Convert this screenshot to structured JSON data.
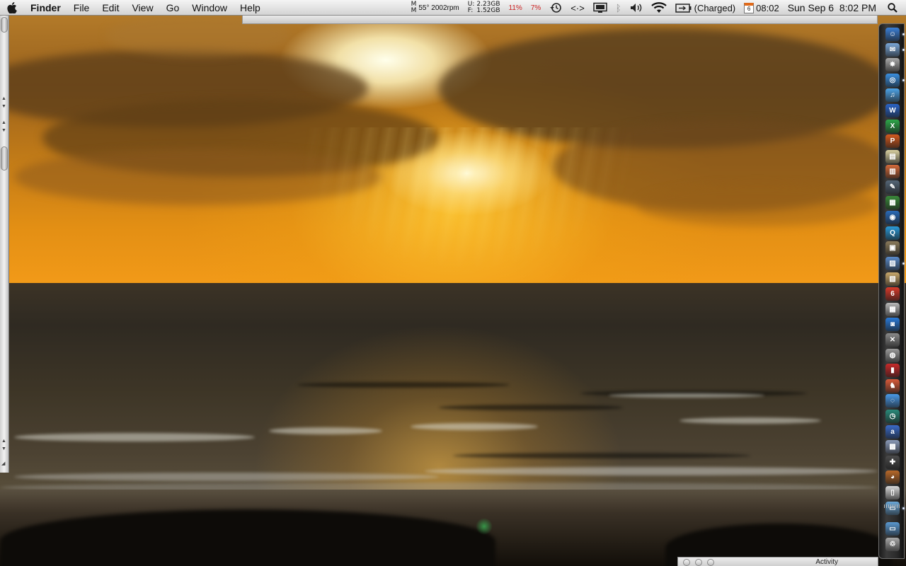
{
  "menubar": {
    "app_name": "Finder",
    "menus": [
      "File",
      "Edit",
      "View",
      "Go",
      "Window",
      "Help"
    ],
    "extras": {
      "temp_top": "M",
      "temp_bottom": "M",
      "temp_fan": "55° 2002rpm",
      "mem_u_label": "U:",
      "mem_f_label": "F:",
      "mem_used": "2.23GB",
      "mem_free": "1.52GB",
      "cpu1": "11%",
      "cpu2": "7%",
      "battery_status": "(Charged)",
      "calendar_day": "6",
      "time_short": "08:02",
      "datetime": "Sun Sep 6  8:02 PM"
    }
  },
  "dock": {
    "icons": [
      {
        "name": "finder-icon",
        "color": "#3b7fd6",
        "glyph": "☺"
      },
      {
        "name": "mail-icon",
        "color": "#7aa7d8",
        "glyph": "✉"
      },
      {
        "name": "compass-icon",
        "color": "#aaaaaa",
        "glyph": "✵"
      },
      {
        "name": "safari-icon",
        "color": "#3a8fe0",
        "glyph": "◎"
      },
      {
        "name": "itunes-icon",
        "color": "#4ea4e8",
        "glyph": "♫"
      },
      {
        "name": "word-icon",
        "color": "#2a64c8",
        "glyph": "W"
      },
      {
        "name": "excel-icon",
        "color": "#2ea84a",
        "glyph": "X"
      },
      {
        "name": "powerpoint-icon",
        "color": "#d45a1e",
        "glyph": "P"
      },
      {
        "name": "notes-icon",
        "color": "#d8cfa0",
        "glyph": "▤"
      },
      {
        "name": "clipboard-icon",
        "color": "#d46a3a",
        "glyph": "▥"
      },
      {
        "name": "feather-icon",
        "color": "#556677",
        "glyph": "✎"
      },
      {
        "name": "chart-icon",
        "color": "#3a8a3a",
        "glyph": "▦"
      },
      {
        "name": "globe-icon",
        "color": "#2a6ab8",
        "glyph": "◉"
      },
      {
        "name": "quicktime-icon",
        "color": "#2a9ad8",
        "glyph": "Q"
      },
      {
        "name": "photo-icon",
        "color": "#8a7a5a",
        "glyph": "▣"
      },
      {
        "name": "iphoto-icon",
        "color": "#5a8ac8",
        "glyph": "▨"
      },
      {
        "name": "scroll-icon",
        "color": "#c8a86a",
        "glyph": "▧"
      },
      {
        "name": "calendar-icon",
        "color": "#d83a2a",
        "glyph": "6"
      },
      {
        "name": "calculator-icon",
        "color": "#b8b8b8",
        "glyph": "▦"
      },
      {
        "name": "camera-icon",
        "color": "#2a7ad8",
        "glyph": "◙"
      },
      {
        "name": "tools-icon",
        "color": "#8a8a8a",
        "glyph": "✕"
      },
      {
        "name": "disk-utility-icon",
        "color": "#9a9a9a",
        "glyph": "◍"
      },
      {
        "name": "book-icon",
        "color": "#c82a2a",
        "glyph": "▮"
      },
      {
        "name": "chess-icon",
        "color": "#d85a3a",
        "glyph": "♞"
      },
      {
        "name": "chat-icon",
        "color": "#4a9ae8",
        "glyph": "◌"
      },
      {
        "name": "time-machine-icon",
        "color": "#2a8a7a",
        "glyph": "◷"
      },
      {
        "name": "amazon-icon",
        "color": "#3a6ac8",
        "glyph": "a"
      },
      {
        "name": "preview-icon",
        "color": "#8a9ab8",
        "glyph": "▩"
      },
      {
        "name": "utility-icon",
        "color": "#4a4a4a",
        "glyph": "✚"
      },
      {
        "name": "coffee-icon",
        "color": "#b8682a",
        "glyph": "◕"
      },
      {
        "name": "document-icon",
        "color": "#d8d8d8",
        "glyph": "▯"
      },
      {
        "name": "folder-icon",
        "color": "#6aa8d8",
        "glyph": "▭"
      },
      {
        "name": "downloads-folder-icon",
        "color": "#5a98d0",
        "glyph": "▭"
      },
      {
        "name": "trash-icon",
        "color": "#a8a8a8",
        "glyph": "♲"
      }
    ],
    "running": [
      0,
      1,
      3,
      15,
      31
    ]
  },
  "activity_window": {
    "title": "Activity"
  }
}
